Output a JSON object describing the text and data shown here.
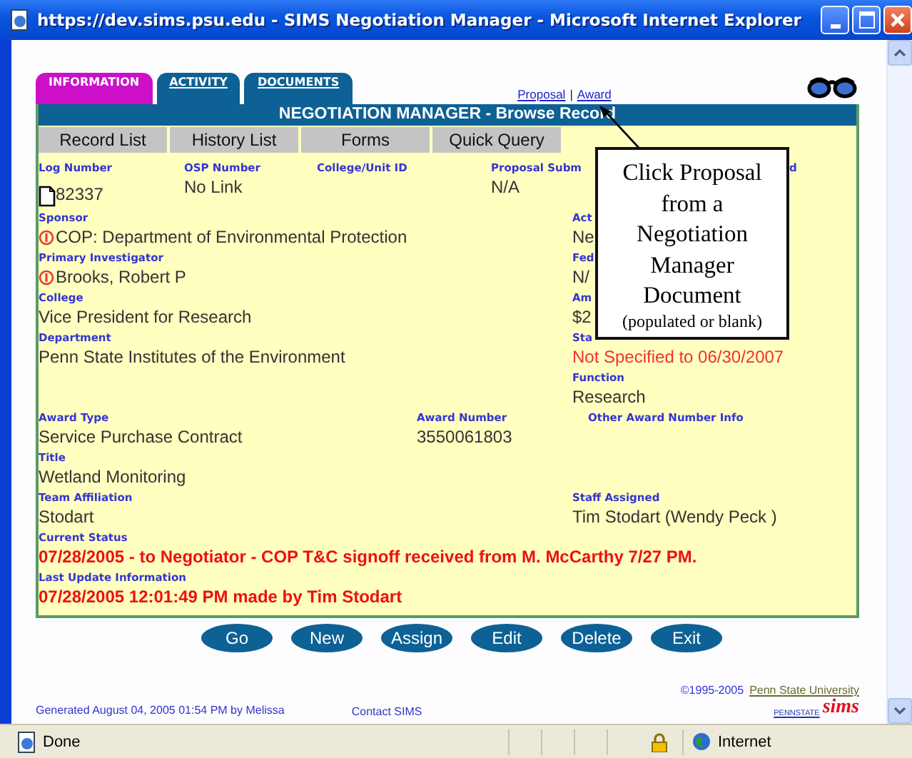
{
  "window": {
    "title": "https://dev.sims.psu.edu - SIMS Negotiation Manager - Microsoft Internet Explorer"
  },
  "tabs": [
    {
      "label": "INFORMATION",
      "selected": true
    },
    {
      "label": "ACTIVITY",
      "selected": false
    },
    {
      "label": "DOCUMENTS",
      "selected": false
    }
  ],
  "record_links": {
    "items": [
      "Proposal",
      "Award"
    ],
    "separator": "|"
  },
  "panel": {
    "title": "NEGOTIATION MANAGER - Browse Record",
    "nav": [
      "Record List",
      "History List",
      "Forms",
      "Quick Query"
    ],
    "header_fields": [
      {
        "label": "Log Number",
        "value": "82337",
        "kind": "document"
      },
      {
        "label": "OSP Number",
        "value": "No Link",
        "kind": "plain"
      },
      {
        "label": "College/Unit ID",
        "kind": "plain"
      },
      {
        "label": "Proposal Subm",
        "value": "N/A",
        "kind": "plain"
      },
      {
        "label": "d",
        "kind": "plain"
      }
    ],
    "left_fields": [
      {
        "label": "Sponsor",
        "value": "COP: Department of Environmental Protection",
        "kind": "flagged"
      },
      {
        "label": "Primary Investigator",
        "value": "Brooks, Robert P",
        "kind": "flagged"
      },
      {
        "label": "College",
        "value": "Vice President for Research",
        "kind": "plain"
      },
      {
        "label": "Department",
        "value": "Penn State Institutes of the Environment",
        "kind": "plain"
      }
    ],
    "right_fields": [
      {
        "label": "Act",
        "value": "Ne",
        "kind": "plain",
        "warning": false
      },
      {
        "label": "Fed",
        "value": "N/",
        "kind": "plain",
        "warning": false
      },
      {
        "label": "Am",
        "value": "$2",
        "kind": "plain",
        "warning": false
      },
      {
        "label": "Sta",
        "value": "Not Specified to 06/30/2007",
        "kind": "plain",
        "warning": true
      },
      {
        "label": "Function",
        "value": "Research",
        "kind": "plain",
        "warning": false
      }
    ],
    "award_fields": [
      {
        "label": "Award Type",
        "value": "Service Purchase Contract",
        "kind": "plain"
      },
      {
        "label": "Award Number",
        "value": "3550061803",
        "kind": "plain"
      },
      {
        "label": "Other Award Number Info",
        "kind": "plain"
      }
    ],
    "title_field": {
      "label": "Title",
      "value": "Wetland Monitoring",
      "kind": "plain"
    },
    "team_fields": [
      {
        "label": "Team Affiliation",
        "value": "Stodart",
        "kind": "plain"
      },
      {
        "label": "Staff Assigned",
        "value": "Tim Stodart (Wendy Peck )",
        "kind": "plain"
      }
    ],
    "status_fields": [
      {
        "label": "Current Status",
        "value": "07/28/2005 - to Negotiator - COP T&C signoff received from M. McCarthy 7/27 PM.",
        "kind": "plain",
        "warning": true
      },
      {
        "label": "Last Update Information",
        "value": "07/28/2005 12:01:49 PM made by Tim Stodart",
        "kind": "plain",
        "warning": true
      }
    ]
  },
  "callout": {
    "text": "Click Proposal from a Negotiation Manager Document",
    "note": "(populated or blank)"
  },
  "buttons": [
    "Go",
    "New",
    "Assign",
    "Edit",
    "Delete",
    "Exit"
  ],
  "footer": {
    "copyright": "©1995-2005",
    "owner_link": "Penn State University",
    "generated": "Generated August 04, 2005 01:54 PM by Melissa",
    "contact_link": "Contact SIMS",
    "logo_wordmark": "PENNSTATE",
    "logo_script": "sims"
  },
  "status_bar": {
    "text": "Done",
    "zone": "Internet"
  }
}
